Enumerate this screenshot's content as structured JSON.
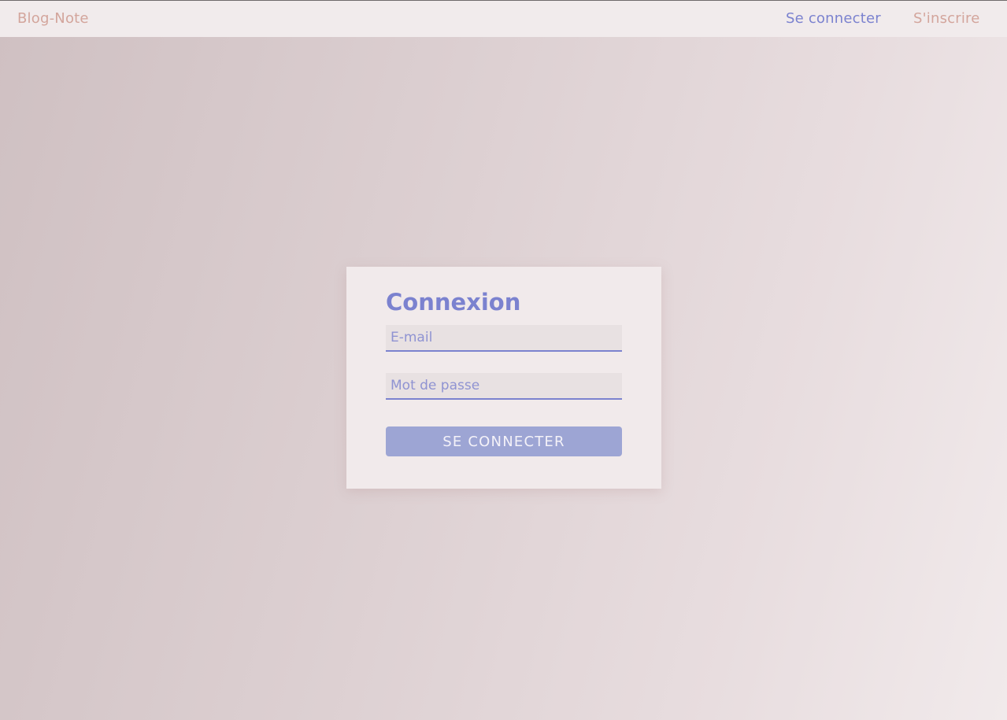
{
  "header": {
    "brand": "Blog-Note",
    "nav": {
      "login": "Se connecter",
      "signup": "S'inscrire"
    }
  },
  "login_card": {
    "title": "Connexion",
    "email_placeholder": "E-mail",
    "password_placeholder": "Mot de passe",
    "submit_label": "SE CONNECTER"
  },
  "colors": {
    "accent": "#7b82cf",
    "brand": "#d3a59c",
    "button": "#9da5d4",
    "card": "#f1eaeb",
    "navbar": "#f1ebec"
  }
}
